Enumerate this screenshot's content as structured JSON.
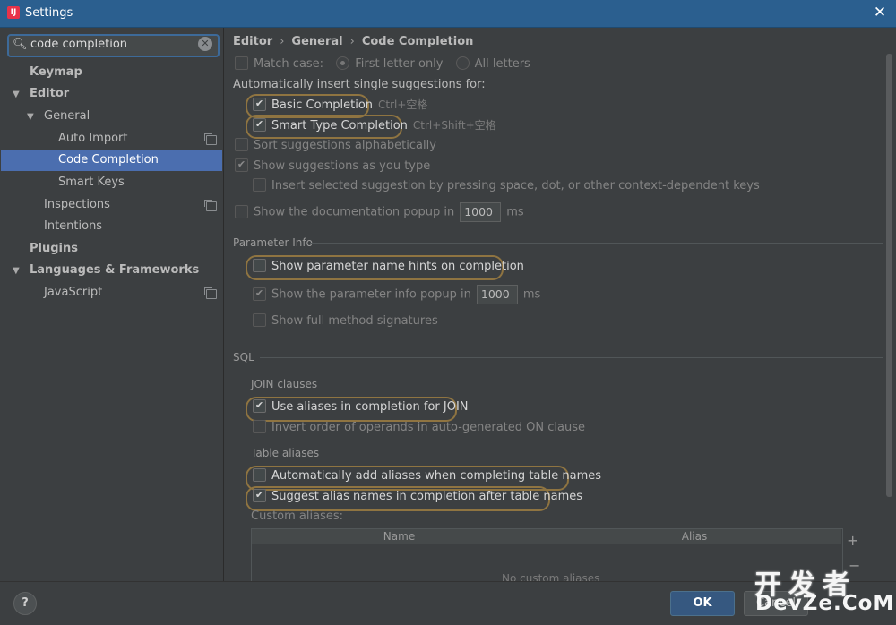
{
  "window": {
    "title": "Settings",
    "close_icon": "close-icon",
    "app_icon_letter": "IJ"
  },
  "search": {
    "value": "code completion"
  },
  "sidebar": {
    "items": [
      {
        "label": "Keymap"
      },
      {
        "label": "Editor"
      },
      {
        "label": "General"
      },
      {
        "label": "Auto Import"
      },
      {
        "label": "Code Completion"
      },
      {
        "label": "Smart Keys"
      },
      {
        "label": "Inspections"
      },
      {
        "label": "Intentions"
      },
      {
        "label": "Plugins"
      },
      {
        "label": "Languages & Frameworks"
      },
      {
        "label": "JavaScript"
      }
    ]
  },
  "breadcrumb": {
    "items": [
      "Editor",
      "General",
      "Code Completion"
    ]
  },
  "options": {
    "match_case": "Match case:",
    "first_letter_only": "First letter only",
    "all_letters": "All letters",
    "auto_insert_label": "Automatically insert single suggestions for:",
    "basic_completion": "Basic Completion",
    "basic_shortcut": "Ctrl+空格",
    "smart_type_completion": "Smart Type Completion",
    "smart_shortcut": "Ctrl+Shift+空格",
    "sort_alpha": "Sort suggestions alphabetically",
    "show_as_you_type": "Show suggestions as you type",
    "insert_selected": "Insert selected suggestion by pressing space, dot, or other context-dependent keys",
    "show_doc_popup": "Show the documentation popup in",
    "doc_popup_ms": "1000",
    "ms": "ms"
  },
  "parameter_info": {
    "section": "Parameter Info",
    "show_name_hints": "Show parameter name hints on completion",
    "show_info_popup": "Show the parameter info popup in",
    "info_popup_ms": "1000",
    "ms": "ms",
    "show_full_signatures": "Show full method signatures"
  },
  "sql": {
    "section": "SQL",
    "join_clauses": "JOIN clauses",
    "use_aliases_join": "Use aliases in completion for JOIN",
    "invert_order": "Invert order of operands in auto-generated ON clause",
    "table_aliases": "Table aliases",
    "auto_add_aliases": "Automatically add aliases when completing table names",
    "suggest_alias_names": "Suggest alias names in completion after table names",
    "custom_aliases": "Custom aliases:",
    "table": {
      "col_name": "Name",
      "col_alias": "Alias",
      "empty_text": "No custom aliases"
    }
  },
  "buttons": {
    "help": "?",
    "ok": "OK",
    "cancel": "Cancel"
  },
  "watermark": {
    "line1": "开发者",
    "line2": "DevZe.CoM"
  },
  "colors": {
    "selection": "#4b6eaf",
    "highlight_ring": "#8f7441",
    "title_bar": "#2b5f8f",
    "ok_button": "#365880"
  }
}
